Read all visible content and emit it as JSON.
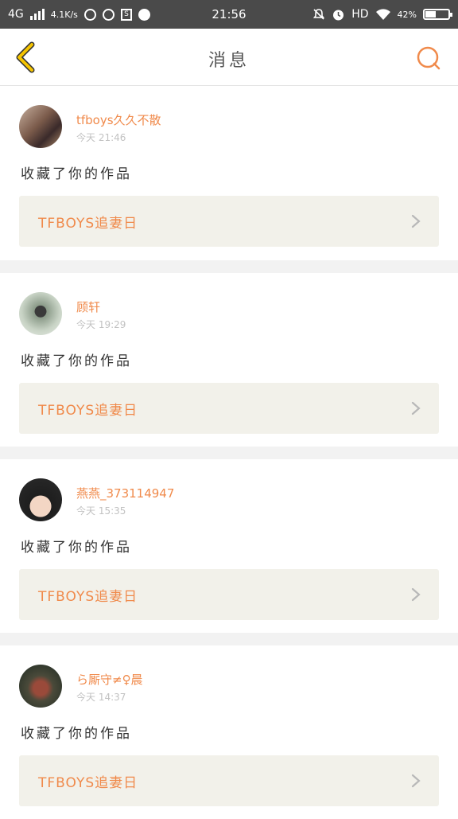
{
  "status_bar": {
    "network": "4G",
    "speed": "4.1K/s",
    "time": "21:56",
    "hd": "HD",
    "battery": "42%"
  },
  "header": {
    "title": "消息",
    "back_icon": "chevron-left-icon",
    "search_icon": "search-icon"
  },
  "colors": {
    "accent": "#f08a4b",
    "back_icon": "#f5c400",
    "card_link_bg": "#f2f1ea"
  },
  "messages": [
    {
      "user": "tfboys久久不散",
      "time": "今天 21:46",
      "action": "收藏了你的作品",
      "work_title": "TFBOYS追妻日"
    },
    {
      "user": "顾轩",
      "time": "今天 19:29",
      "action": "收藏了你的作品",
      "work_title": "TFBOYS追妻日"
    },
    {
      "user": "燕燕_373114947",
      "time": "今天 15:35",
      "action": "收藏了你的作品",
      "work_title": "TFBOYS追妻日"
    },
    {
      "user": "ら厮守≠♀晨",
      "time": "今天 14:37",
      "action": "收藏了你的作品",
      "work_title": "TFBOYS追妻日"
    }
  ]
}
